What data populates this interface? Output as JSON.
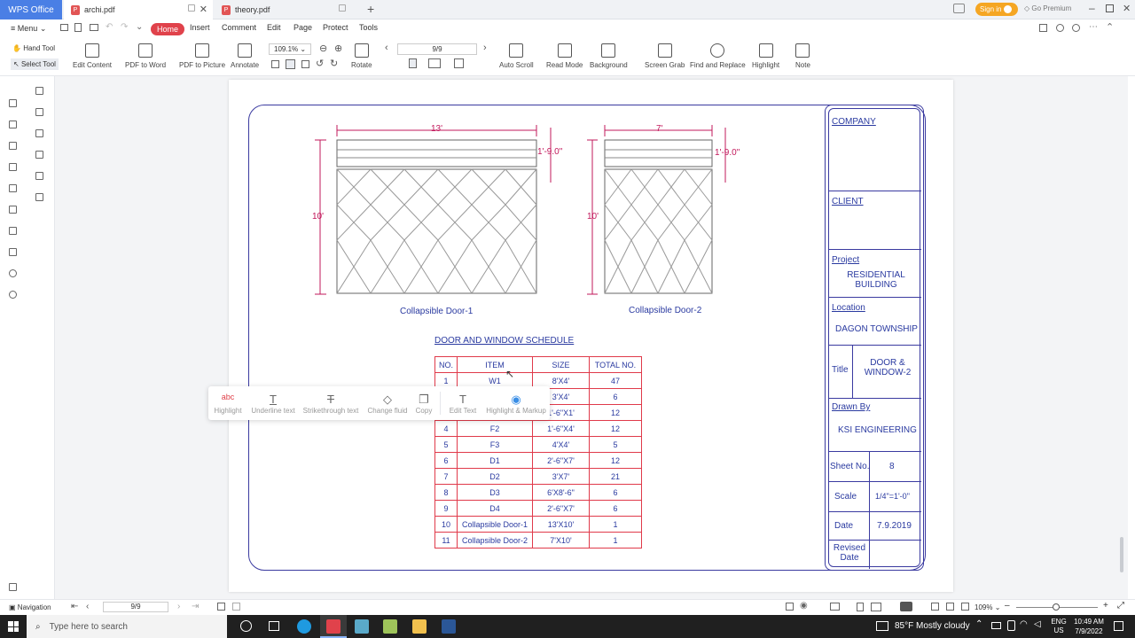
{
  "titlebar": {
    "app": "WPS Office",
    "tabs": [
      {
        "label": "archi.pdf"
      },
      {
        "label": "theory.pdf"
      }
    ],
    "signin": "Sign in",
    "premium": "Go Premium"
  },
  "menubar": {
    "menu": "Menu",
    "items": [
      "Home",
      "Insert",
      "Comment",
      "Edit",
      "Page",
      "Protect",
      "Tools"
    ]
  },
  "toolbar": {
    "hand_tool": "Hand Tool",
    "select_tool": "Select Tool",
    "edit_content": "Edit Content",
    "pdf_to_word": "PDF to Word",
    "pdf_to_picture": "PDF to Picture",
    "annotate": "Annotate",
    "zoom": "109.1%",
    "rotate": "Rotate",
    "page": "9/9",
    "auto_scroll": "Auto Scroll",
    "read_mode": "Read Mode",
    "background": "Background",
    "screen_grab": "Screen Grab",
    "find_replace": "Find and Replace",
    "highlight": "Highlight",
    "note": "Note"
  },
  "drawing": {
    "door1": {
      "width": "13'",
      "top": "1'-9.0\"",
      "height": "10'",
      "caption": "Collapsible Door-1"
    },
    "door2": {
      "width": "7'",
      "top": "1'-9.0\"",
      "height": "10'",
      "caption": "Collapsible Door-2"
    },
    "schedule_title": "DOOR AND WINDOW SCHEDULE",
    "schedule_headers": [
      "NO.",
      "ITEM",
      "SIZE",
      "TOTAL NO."
    ],
    "schedule_rows": [
      [
        "1",
        "W1",
        "8'X4'",
        "47"
      ],
      [
        "2",
        "",
        "3'X4'",
        "6"
      ],
      [
        "3",
        "",
        "1'-6\"X1'",
        "12"
      ],
      [
        "4",
        "F2",
        "1'-6\"X4'",
        "12"
      ],
      [
        "5",
        "F3",
        "4'X4'",
        "5"
      ],
      [
        "6",
        "D1",
        "2'-6\"X7'",
        "12"
      ],
      [
        "7",
        "D2",
        "3'X7'",
        "21"
      ],
      [
        "8",
        "D3",
        "6'X8'-6\"",
        "6"
      ],
      [
        "9",
        "D4",
        "2'-6\"X7'",
        "6"
      ],
      [
        "10",
        "Collapsible Door-1",
        "13'X10'",
        "1"
      ],
      [
        "11",
        "Collapsible Door-2",
        "7'X10'",
        "1"
      ]
    ]
  },
  "titleblock": {
    "company": "COMPANY",
    "client": "CLIENT",
    "project_label": "Project",
    "project": "RESIDENTIAL BUILDING",
    "location_label": "Location",
    "location": "DAGON TOWNSHIP",
    "title_label": "Title",
    "title": "DOOR & WINDOW-2",
    "drawn_label": "Drawn By",
    "drawn": "KSI ENGINEERING",
    "sheet_label": "Sheet No.",
    "sheet": "8",
    "scale_label": "Scale",
    "scale": "1/4\"=1'-0\"",
    "date_label": "Date",
    "date": "7.9.2019",
    "revised_label": "Revised Date"
  },
  "popup": {
    "items": [
      "Highlight",
      "Underline text",
      "Strikethrough text",
      "Change fluid",
      "Copy",
      "Edit Text",
      "Highlight & Markup"
    ]
  },
  "statusbar": {
    "navigation": "Navigation",
    "page": "9/9",
    "zoom": "109%"
  },
  "taskbar": {
    "search": "Type here to search",
    "weather": "85°F  Mostly cloudy",
    "lang": "ENG US",
    "time": "10:49 AM",
    "date": "7/9/2022"
  }
}
